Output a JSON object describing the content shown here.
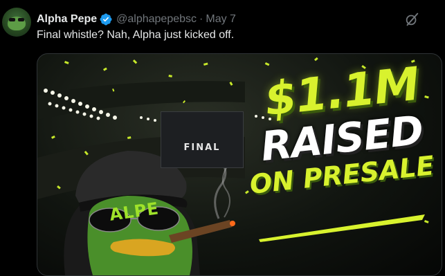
{
  "tweet": {
    "author_name": "Alpha Pepe",
    "handle": "@alphapepebsc",
    "separator": "·",
    "date": "May 7",
    "text": "Final whistle? Nah, Alpha just kicked off.",
    "verified_color": "#1d9bf0",
    "grok_icon": "grok-icon"
  },
  "media": {
    "scoreboard_text": "FINAL",
    "cap_text": "ALPE",
    "headline_amount": "$1.1M",
    "headline_raised": "RAISED",
    "headline_presale": "ON PRESALE",
    "accent_color": "#d8f22e"
  }
}
